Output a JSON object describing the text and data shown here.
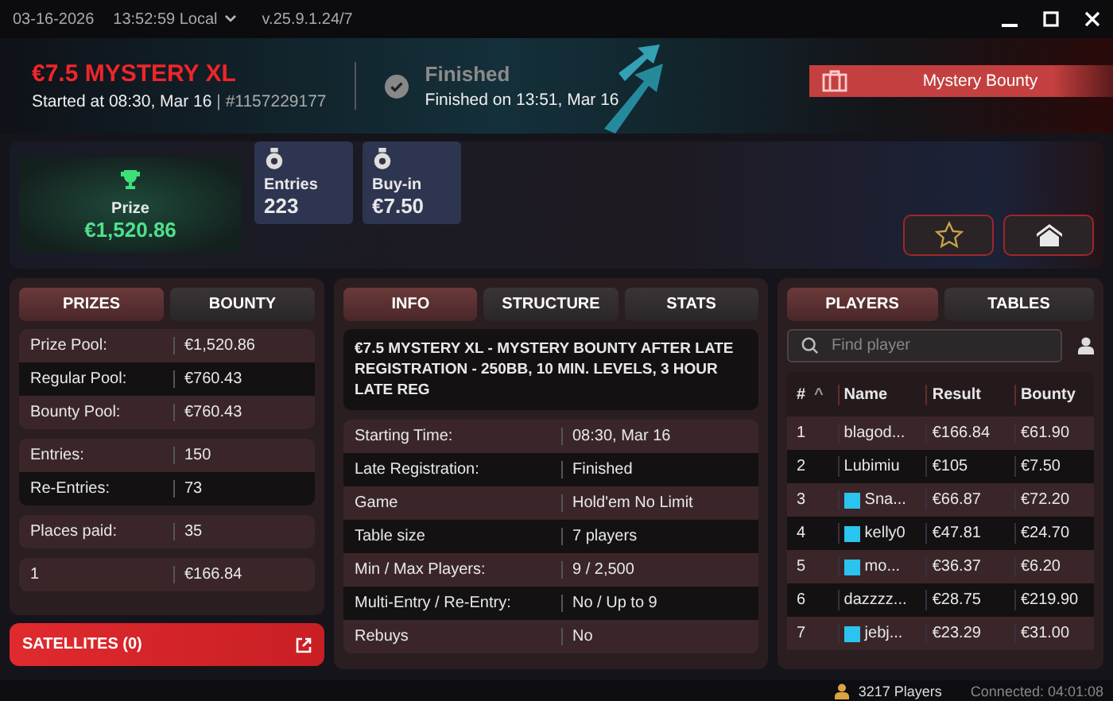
{
  "title_bar": {
    "date": "03-16-2026",
    "time": "13:52:59 Local",
    "version": "v.25.9.1.24/7"
  },
  "header": {
    "title": "€7.5 MYSTERY XL",
    "started": "Started at 08:30, Mar 16",
    "separator": "|",
    "id": "#1157229177",
    "status": "Finished",
    "finished": "Finished on 13:51, Mar 16",
    "badge": "Mystery Bounty"
  },
  "stats": {
    "prize_label": "Prize",
    "prize": "€1,520.86",
    "cards": [
      {
        "label": "Entries",
        "value": "223"
      },
      {
        "label": "Buy-in",
        "value": "€7.50"
      }
    ]
  },
  "left_tabs": [
    {
      "label": "PRIZES",
      "selected": true
    },
    {
      "label": "BOUNTY",
      "selected": false
    }
  ],
  "prize_groups": [
    [
      {
        "label": "Prize Pool:",
        "value": "€1,520.86"
      },
      {
        "label": "Regular Pool:",
        "value": "€760.43"
      },
      {
        "label": "Bounty Pool:",
        "value": "€760.43"
      }
    ],
    [
      {
        "label": "Entries:",
        "value": "150"
      },
      {
        "label": "Re-Entries:",
        "value": "73"
      }
    ],
    [
      {
        "label": "Places paid:",
        "value": "35"
      }
    ],
    [
      {
        "label": "1",
        "value": "€166.84"
      }
    ]
  ],
  "satellites": "SATELLITES (0)",
  "info_tabs": [
    {
      "label": "INFO",
      "selected": true
    },
    {
      "label": "STRUCTURE",
      "selected": false
    },
    {
      "label": "STATS",
      "selected": false
    }
  ],
  "description": "€7.5 MYSTERY XL - MYSTERY BOUNTY AFTER LATE REGISTRATION - 250BB, 10 MIN. LEVELS, 3 HOUR LATE REG",
  "info_rows": [
    {
      "label": "Starting Time:",
      "value": "08:30, Mar 16"
    },
    {
      "label": "Late Registration:",
      "value": "Finished"
    },
    {
      "label": "Game",
      "value": "Hold'em No Limit"
    },
    {
      "label": "Table size",
      "value": "7 players"
    },
    {
      "label": "Min / Max Players:",
      "value": "9 / 2,500"
    },
    {
      "label": "Multi-Entry / Re-Entry:",
      "value": "No / Up to 9"
    },
    {
      "label": "Rebuys",
      "value": "No"
    }
  ],
  "player_tabs": [
    {
      "label": "PLAYERS",
      "selected": true
    },
    {
      "label": "TABLES",
      "selected": false
    }
  ],
  "search": {
    "placeholder": "Find player"
  },
  "columns": [
    "#",
    "^",
    "Name",
    "Result",
    "Bounty"
  ],
  "players": [
    {
      "rank": "1",
      "name": "blagod...",
      "result": "€166.84",
      "bounty": "€61.90",
      "flag": false
    },
    {
      "rank": "2",
      "name": "Lubimiu",
      "result": "€105",
      "bounty": "€7.50",
      "flag": false
    },
    {
      "rank": "3",
      "name": "Sna...",
      "result": "€66.87",
      "bounty": "€72.20",
      "flag": true
    },
    {
      "rank": "4",
      "name": "kelly0",
      "result": "€47.81",
      "bounty": "€24.70",
      "flag": true
    },
    {
      "rank": "5",
      "name": "mo...",
      "result": "€36.37",
      "bounty": "€6.20",
      "flag": true
    },
    {
      "rank": "6",
      "name": "dazzzz...",
      "result": "€28.75",
      "bounty": "€219.90",
      "flag": false
    },
    {
      "rank": "7",
      "name": "jebj...",
      "result": "€23.29",
      "bounty": "€31.00",
      "flag": true
    }
  ],
  "status_bar": {
    "players": "3217 Players",
    "connected": "Connected: 04:01:08"
  }
}
